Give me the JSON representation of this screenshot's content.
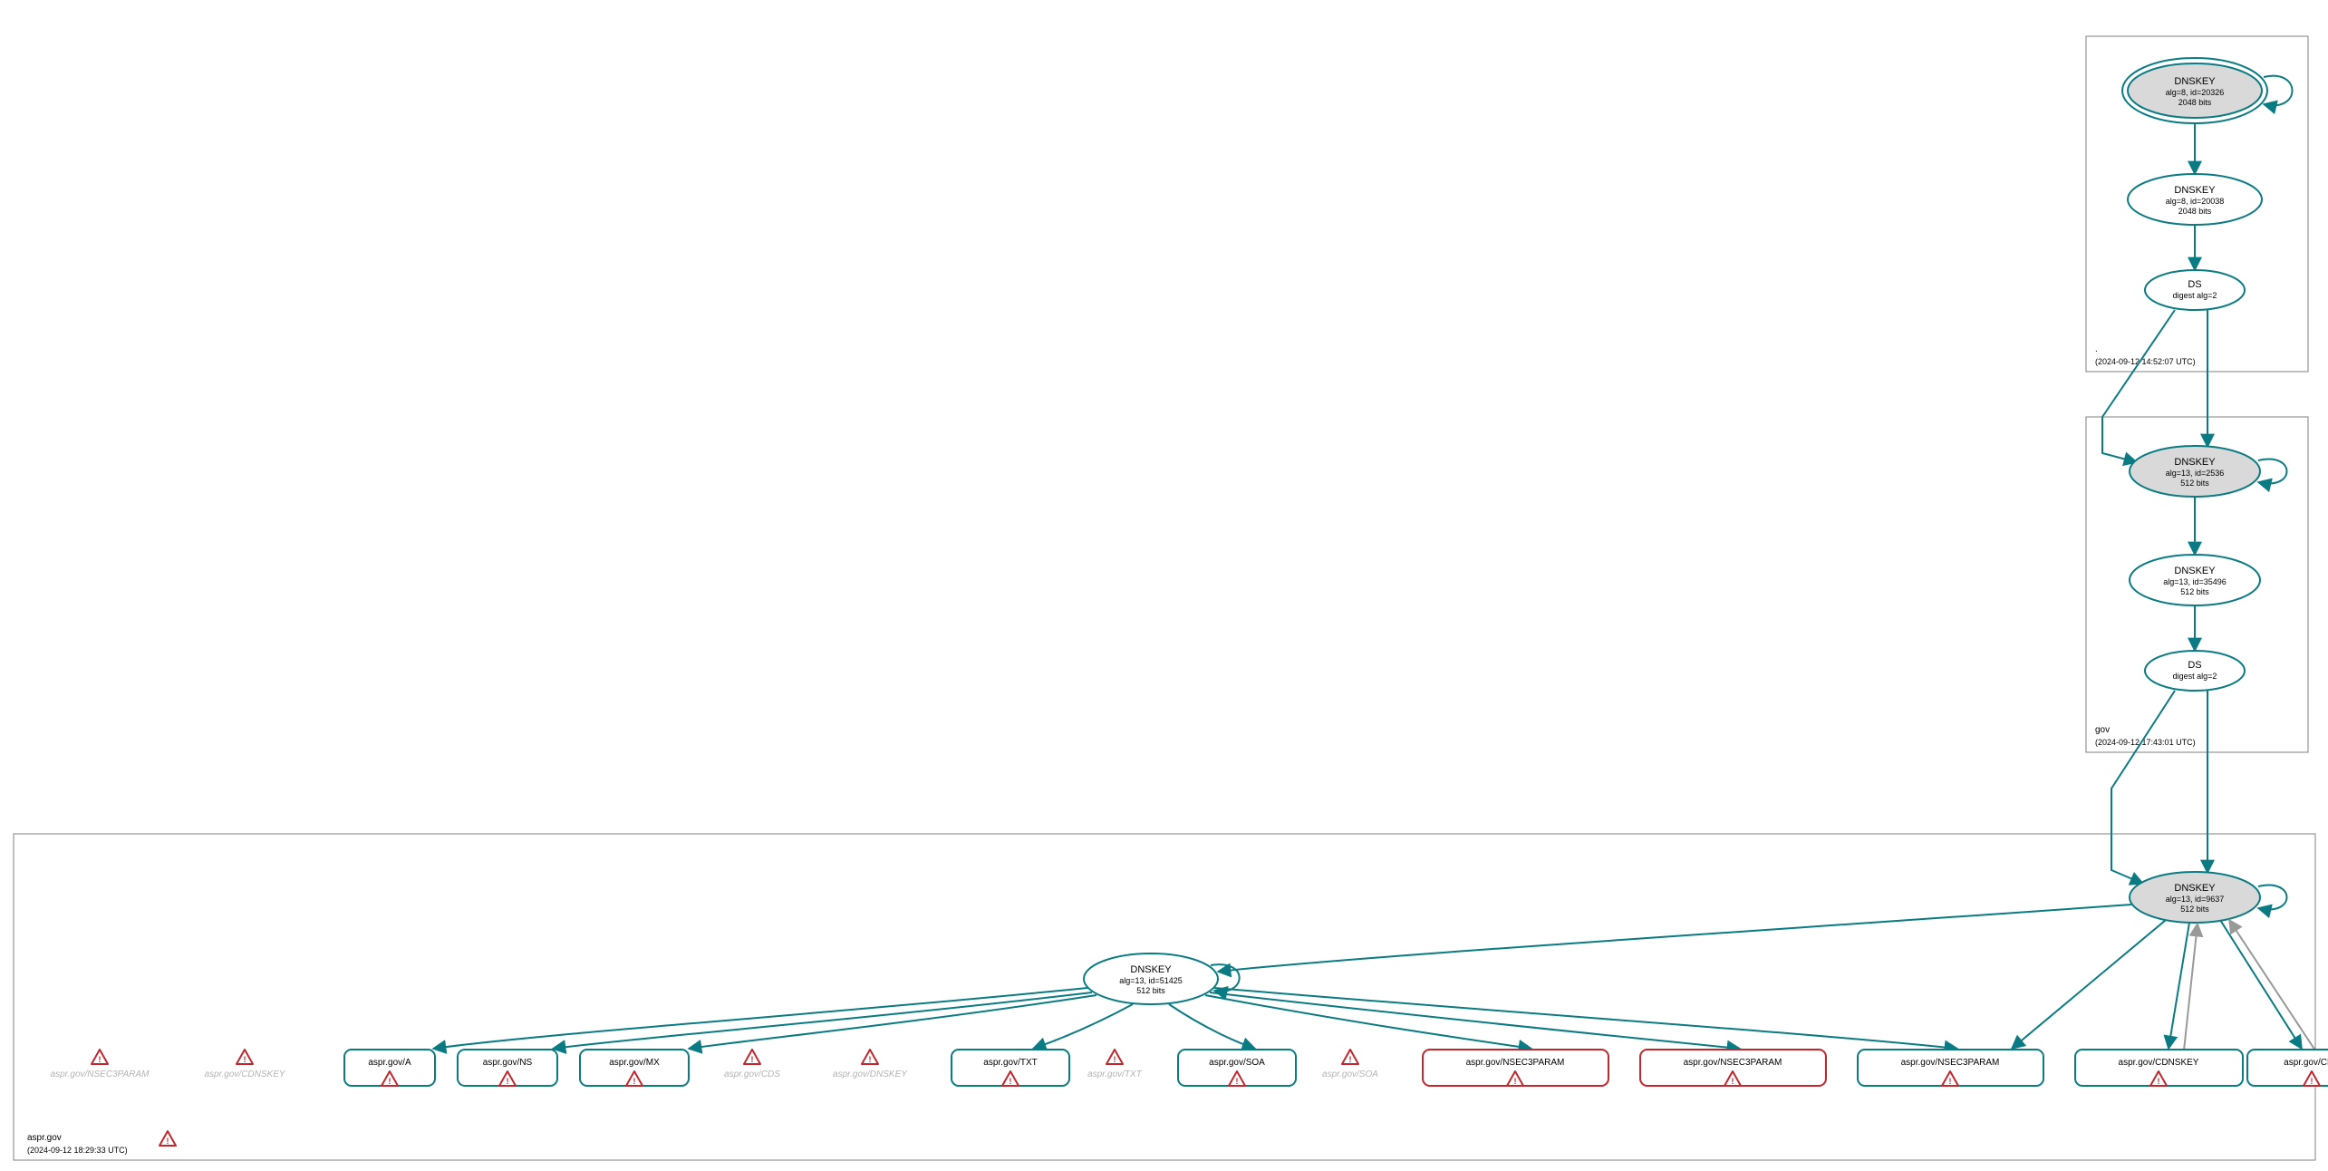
{
  "zones": {
    "root": {
      "name": ".",
      "date": "(2024-09-12 14:52:07 UTC)"
    },
    "gov": {
      "name": "gov",
      "date": "(2024-09-12 17:43:01 UTC)"
    },
    "aspr": {
      "name": "aspr.gov",
      "date": "(2024-09-12 18:29:33 UTC)"
    }
  },
  "nodes": {
    "root_ksk": {
      "title": "DNSKEY",
      "sub1": "alg=8, id=20326",
      "sub2": "2048 bits"
    },
    "root_zsk": {
      "title": "DNSKEY",
      "sub1": "alg=8, id=20038",
      "sub2": "2048 bits"
    },
    "root_ds": {
      "title": "DS",
      "sub1": "digest alg=2"
    },
    "gov_ksk": {
      "title": "DNSKEY",
      "sub1": "alg=13, id=2536",
      "sub2": "512 bits"
    },
    "gov_zsk": {
      "title": "DNSKEY",
      "sub1": "alg=13, id=35496",
      "sub2": "512 bits"
    },
    "gov_ds": {
      "title": "DS",
      "sub1": "digest alg=2"
    },
    "aspr_ksk": {
      "title": "DNSKEY",
      "sub1": "alg=13, id=9637",
      "sub2": "512 bits"
    },
    "aspr_zsk": {
      "title": "DNSKEY",
      "sub1": "alg=13, id=51425",
      "sub2": "512 bits"
    }
  },
  "rrsets": {
    "a": {
      "label": "aspr.gov/A"
    },
    "ns": {
      "label": "aspr.gov/NS"
    },
    "mx": {
      "label": "aspr.gov/MX"
    },
    "txt": {
      "label": "aspr.gov/TXT"
    },
    "soa": {
      "label": "aspr.gov/SOA"
    },
    "n3p1": {
      "label": "aspr.gov/NSEC3PARAM"
    },
    "n3p2": {
      "label": "aspr.gov/NSEC3PARAM"
    },
    "n3p3": {
      "label": "aspr.gov/NSEC3PARAM"
    },
    "cdnskey": {
      "label": "aspr.gov/CDNSKEY"
    },
    "cds": {
      "label": "aspr.gov/CDS"
    }
  },
  "phantoms": {
    "p1": "aspr.gov/NSEC3PARAM",
    "p2": "aspr.gov/CDNSKEY",
    "p3": "aspr.gov/CDS",
    "p4": "aspr.gov/DNSKEY",
    "p5": "aspr.gov/TXT",
    "p6": "aspr.gov/SOA"
  }
}
